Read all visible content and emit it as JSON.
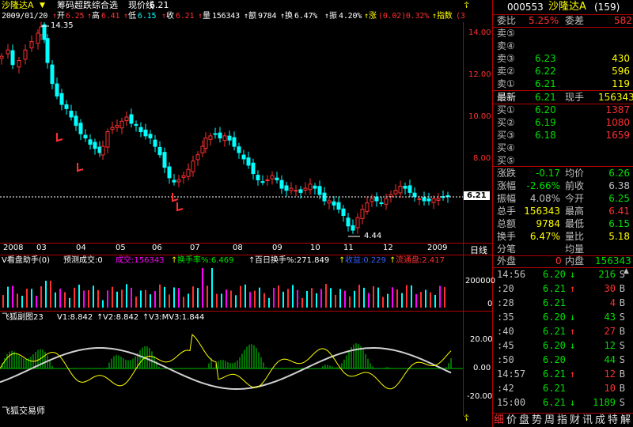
{
  "header": {
    "stock_name": "沙隆达A",
    "indicator_title": "筹码超跌综合选",
    "price_line_label": "现价线",
    "price_line_value": "6.21",
    "date": "2009/01/20",
    "open_label": "开",
    "open": "6.25",
    "high_label": "高",
    "high": "6.41",
    "low_label": "低",
    "low": "6.15",
    "close_label": "收",
    "close": "6.21",
    "vol_label": "量",
    "vol": "156343",
    "amt_label": "额",
    "amt": "9784",
    "turn_label": "换",
    "turn": "6.47%",
    "amp_label": "振",
    "amp": "4.20%",
    "chg_label": "涨",
    "chg": "(0.02)0.32%",
    "idx_label": "指数",
    "idx": "(3"
  },
  "main_chart": {
    "y_ticks": [
      "14.00",
      "12.00",
      "10.00",
      "8.00"
    ],
    "current_price_tag": "6.21",
    "high_annotation": "14.35",
    "low_annotation": "4.44",
    "x_labels": [
      "2008",
      "03",
      "04",
      "05",
      "06",
      "07",
      "08",
      "09",
      "10",
      "11",
      "12",
      "2009"
    ],
    "period_label": "日线"
  },
  "volume_panel": {
    "title": "V看盘助手(0)",
    "predict_label": "预测成交:0",
    "turnover": "成交:156343",
    "turn_rate": "换手率%:6.469",
    "hundred_day": "百日换手%:271.849",
    "profit": "收益:0.229",
    "float": "流通盘:2.417",
    "y_ticks": [
      "200000",
      "0"
    ]
  },
  "osc_panel": {
    "title": "飞狐副图23",
    "v1": "V1:8.842",
    "v2": "V2:8.842",
    "v3": "V3:MV3:1.844",
    "y_ticks": [
      "20.00",
      "0.00",
      "-20.00"
    ],
    "footer": "飞狐交易师"
  },
  "quote": {
    "code": "000553",
    "name": "沙隆达A",
    "count": "(159)",
    "wei_bi_label": "委比",
    "wei_bi": "5.25%",
    "wei_cha_label": "委差",
    "wei_cha": "582",
    "sell": [
      {
        "label": "卖⑤",
        "price": "",
        "vol": ""
      },
      {
        "label": "卖④",
        "price": "",
        "vol": ""
      },
      {
        "label": "卖③",
        "price": "6.23",
        "vol": "430"
      },
      {
        "label": "卖②",
        "price": "6.22",
        "vol": "596"
      },
      {
        "label": "卖①",
        "price": "6.21",
        "vol": "119"
      }
    ],
    "latest_label": "最新",
    "latest": "6.21",
    "now_vol_label": "现手",
    "now_vol": "156343",
    "buy": [
      {
        "label": "买①",
        "price": "6.20",
        "vol": "1387"
      },
      {
        "label": "买②",
        "price": "6.19",
        "vol": "1080"
      },
      {
        "label": "买③",
        "price": "6.18",
        "vol": "1659"
      },
      {
        "label": "买④",
        "price": "",
        "vol": ""
      },
      {
        "label": "买⑤",
        "price": "",
        "vol": ""
      }
    ],
    "stats": [
      {
        "l1": "涨跌",
        "v1": "-0.17",
        "l2": "均价",
        "v2": "6.26",
        "c1": "#00e000",
        "c2": "#00e000"
      },
      {
        "l1": "涨幅",
        "v1": "-2.66%",
        "l2": "前收",
        "v2": "6.38",
        "c1": "#00e000",
        "c2": "#c0c0c0"
      },
      {
        "l1": "振幅",
        "v1": "4.08%",
        "l2": "今开",
        "v2": "6.25",
        "c1": "#c0c0c0",
        "c2": "#00e000"
      },
      {
        "l1": "总手",
        "v1": "156343",
        "l2": "最高",
        "v2": "6.41",
        "c1": "#ffff00",
        "c2": "#ff3030"
      },
      {
        "l1": "总额",
        "v1": "9784",
        "l2": "最低",
        "v2": "6.15",
        "c1": "#ffff00",
        "c2": "#00e000"
      },
      {
        "l1": "换手",
        "v1": "6.47%",
        "l2": "量比",
        "v2": "5.18",
        "c1": "#ffff00",
        "c2": "#ffff00"
      },
      {
        "l1": "分笔",
        "v1": "",
        "l2": "均量",
        "v2": "",
        "c1": "#c0c0c0",
        "c2": "#c0c0c0"
      }
    ],
    "outer_label": "外盘",
    "outer": "0",
    "inner_label": "内盘",
    "inner": "156343"
  },
  "ticks": [
    {
      "time": "14:56",
      "price": "6.20",
      "dir": "↓",
      "vol": "216",
      "bs": "S",
      "pc": "#00e000",
      "bc": "#00e000"
    },
    {
      "time": ":20",
      "price": "6.21",
      "dir": "↑",
      "vol": "30",
      "bs": "B",
      "pc": "#00e000",
      "bc": "#ff3030"
    },
    {
      "time": ":28",
      "price": "6.21",
      "dir": "",
      "vol": "4",
      "bs": "B",
      "pc": "#00e000",
      "bc": "#ff3030"
    },
    {
      "time": ":35",
      "price": "6.20",
      "dir": "↓",
      "vol": "43",
      "bs": "S",
      "pc": "#00e000",
      "bc": "#00e000"
    },
    {
      "time": ":40",
      "price": "6.21",
      "dir": "↑",
      "vol": "27",
      "bs": "B",
      "pc": "#00e000",
      "bc": "#ff3030"
    },
    {
      "time": ":45",
      "price": "6.20",
      "dir": "↓",
      "vol": "12",
      "bs": "S",
      "pc": "#00e000",
      "bc": "#00e000"
    },
    {
      "time": ":50",
      "price": "6.20",
      "dir": "",
      "vol": "44",
      "bs": "S",
      "pc": "#00e000",
      "bc": "#00e000"
    },
    {
      "time": "14:57",
      "price": "6.21",
      "dir": "↑",
      "vol": "12",
      "bs": "B",
      "pc": "#00e000",
      "bc": "#ff3030"
    },
    {
      "time": ":42",
      "price": "6.21",
      "dir": "",
      "vol": "10",
      "bs": "B",
      "pc": "#00e000",
      "bc": "#ff3030"
    },
    {
      "time": "15:00",
      "price": "6.21",
      "dir": "↓",
      "vol": "1189",
      "bs": "S",
      "pc": "#00e000",
      "bc": "#00e000"
    }
  ],
  "bottom_tabs": [
    "细",
    "价",
    "盘",
    "势",
    "周",
    "指",
    "财",
    "讯",
    "成",
    "特",
    "解"
  ]
}
